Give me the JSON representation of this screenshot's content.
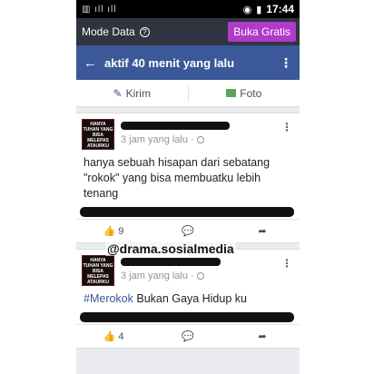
{
  "statusbar": {
    "left_glyphs": "▥ ıll ıll",
    "time": "17:44"
  },
  "modebar": {
    "label": "Mode Data",
    "help_icon": "?",
    "button": "Buka Gratis"
  },
  "navbar": {
    "back_icon": "←",
    "title": "aktif 40 menit yang lalu",
    "menu_icon": "⋮"
  },
  "composer": {
    "write_label": "Kirim",
    "photo_label": "Foto"
  },
  "posts": [
    {
      "avatar_text": "HANYA TUHAN YANG BISA MELEPAS ATAURKU PERGI",
      "time": "3 jam yang lalu ·",
      "text_lines": [
        "hanya sebuah hisapan dari sebatang",
        "\"rokok\" yang bisa membuatku lebih",
        "tenang"
      ],
      "likes": "9"
    },
    {
      "avatar_text": "HANYA TUHAN YANG BISA MELEPAS ATAURKU PERGI",
      "time": "3 jam yang lalu ·",
      "hashtag": "#Merokok",
      "text_rest": " Bukan Gaya Hidup ku",
      "likes": "4"
    }
  ],
  "watermark": "@drama.sosialmedia"
}
